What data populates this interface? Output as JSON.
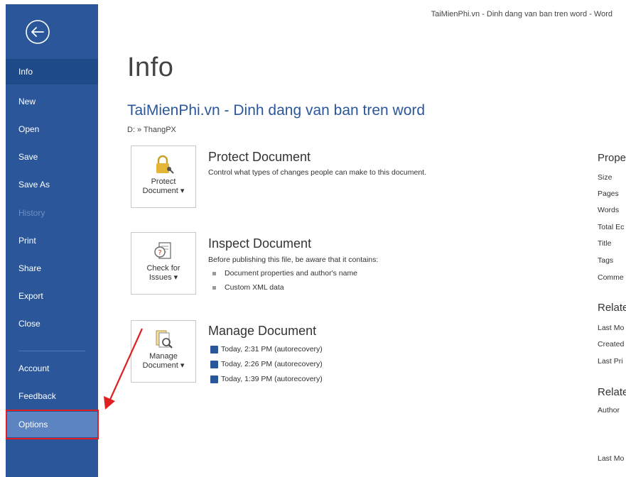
{
  "window": {
    "title": "TaiMienPhi.vn - Dinh dang van ban tren word - Word"
  },
  "sidebar": {
    "items": [
      {
        "label": "Info"
      },
      {
        "label": "New"
      },
      {
        "label": "Open"
      },
      {
        "label": "Save"
      },
      {
        "label": "Save As"
      },
      {
        "label": "History"
      },
      {
        "label": "Print"
      },
      {
        "label": "Share"
      },
      {
        "label": "Export"
      },
      {
        "label": "Close"
      },
      {
        "label": "Account"
      },
      {
        "label": "Feedback"
      },
      {
        "label": "Options"
      }
    ]
  },
  "main": {
    "title": "Info",
    "doc_title": "TaiMienPhi.vn - Dinh dang van ban tren word",
    "path": "D: » ThangPX",
    "protect": {
      "tile_line1": "Protect",
      "tile_line2": "Document ▾",
      "title": "Protect Document",
      "desc": "Control what types of changes people can make to this document."
    },
    "inspect": {
      "tile_line1": "Check for",
      "tile_line2": "Issues ▾",
      "title": "Inspect Document",
      "desc": "Before publishing this file, be aware that it contains:",
      "bullets": [
        "Document properties and author's name",
        "Custom XML data"
      ]
    },
    "manage": {
      "tile_line1": "Manage",
      "tile_line2": "Document ▾",
      "title": "Manage Document",
      "versions": [
        "Today, 2:31 PM (autorecovery)",
        "Today, 2:26 PM (autorecovery)",
        "Today, 1:39 PM (autorecovery)"
      ]
    }
  },
  "properties": {
    "heading": "Prope",
    "labels": [
      "Size",
      "Pages",
      "Words",
      "Total Ec",
      "Title",
      "Tags",
      "Comme"
    ],
    "related_dates_heading": "Relate",
    "date_labels": [
      "Last Mo",
      "Created",
      "Last Pri"
    ],
    "related_people_heading": "Relate",
    "people_labels": [
      "Author",
      "Last Mo"
    ]
  },
  "colors": {
    "sidebar": "#2b579a",
    "accent": "#2b579a",
    "annotation": "#e02020"
  }
}
